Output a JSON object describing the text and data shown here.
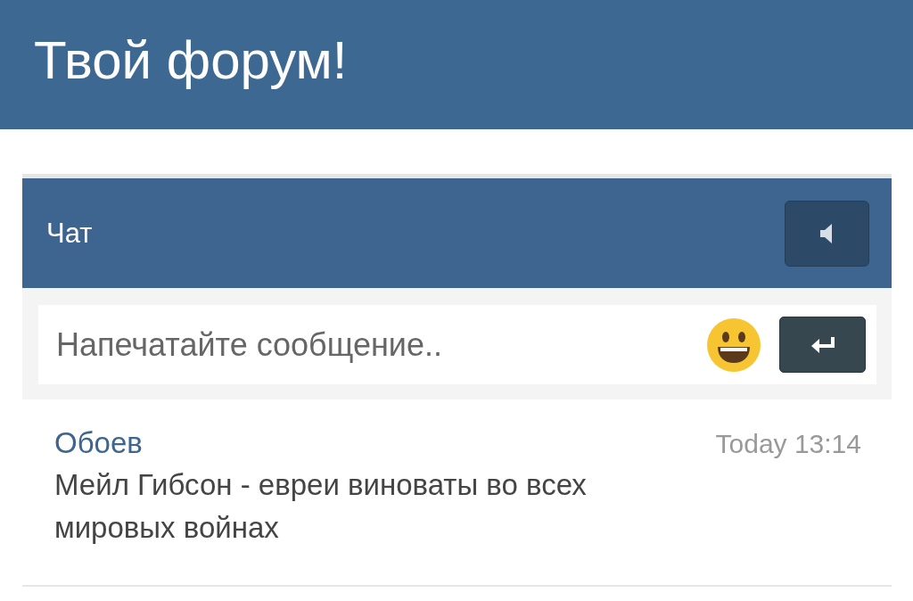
{
  "header": {
    "title": "Твой форум!"
  },
  "chat": {
    "title": "Чат",
    "input": {
      "placeholder": "Напечатайте сообщение.."
    },
    "messages": [
      {
        "author": "Обоев",
        "time": "Today 13:14",
        "text": "Мейл Гибсон - евреи виноваты во всех мировых войнах"
      }
    ]
  }
}
